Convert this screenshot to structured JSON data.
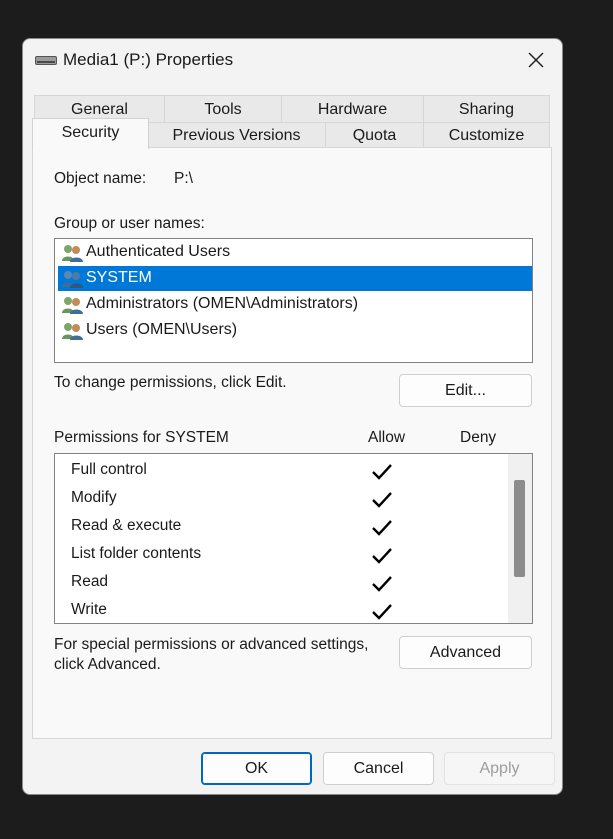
{
  "window": {
    "title": "Media1 (P:) Properties",
    "icon": "drive-icon",
    "close_icon": "close-icon"
  },
  "tabs": {
    "row1": [
      "General",
      "Tools",
      "Hardware",
      "Sharing"
    ],
    "row2": [
      "Security",
      "Previous Versions",
      "Quota",
      "Customize"
    ],
    "selected": "Security"
  },
  "security": {
    "object_name_label": "Object name:",
    "object_name_value": "P:\\",
    "group_label": "Group or user names:",
    "users": [
      {
        "name": "Authenticated Users",
        "selected": false
      },
      {
        "name": "SYSTEM",
        "selected": true
      },
      {
        "name": "Administrators (OMEN\\Administrators)",
        "selected": false
      },
      {
        "name": "Users (OMEN\\Users)",
        "selected": false
      }
    ],
    "change_hint": "To change permissions, click Edit.",
    "edit_button": "Edit...",
    "permissions_label": "Permissions for SYSTEM",
    "allow_header": "Allow",
    "deny_header": "Deny",
    "permissions": [
      {
        "name": "Full control",
        "allow": true,
        "deny": false
      },
      {
        "name": "Modify",
        "allow": true,
        "deny": false
      },
      {
        "name": "Read & execute",
        "allow": true,
        "deny": false
      },
      {
        "name": "List folder contents",
        "allow": true,
        "deny": false
      },
      {
        "name": "Read",
        "allow": true,
        "deny": false
      },
      {
        "name": "Write",
        "allow": true,
        "deny": false
      }
    ],
    "special_line1": "For special permissions or advanced settings,",
    "special_line2": "click Advanced.",
    "advanced_button": "Advanced"
  },
  "footer": {
    "ok": "OK",
    "cancel": "Cancel",
    "apply": "Apply"
  },
  "colors": {
    "selection": "#0078d7",
    "default_button_border": "#0067c0"
  }
}
